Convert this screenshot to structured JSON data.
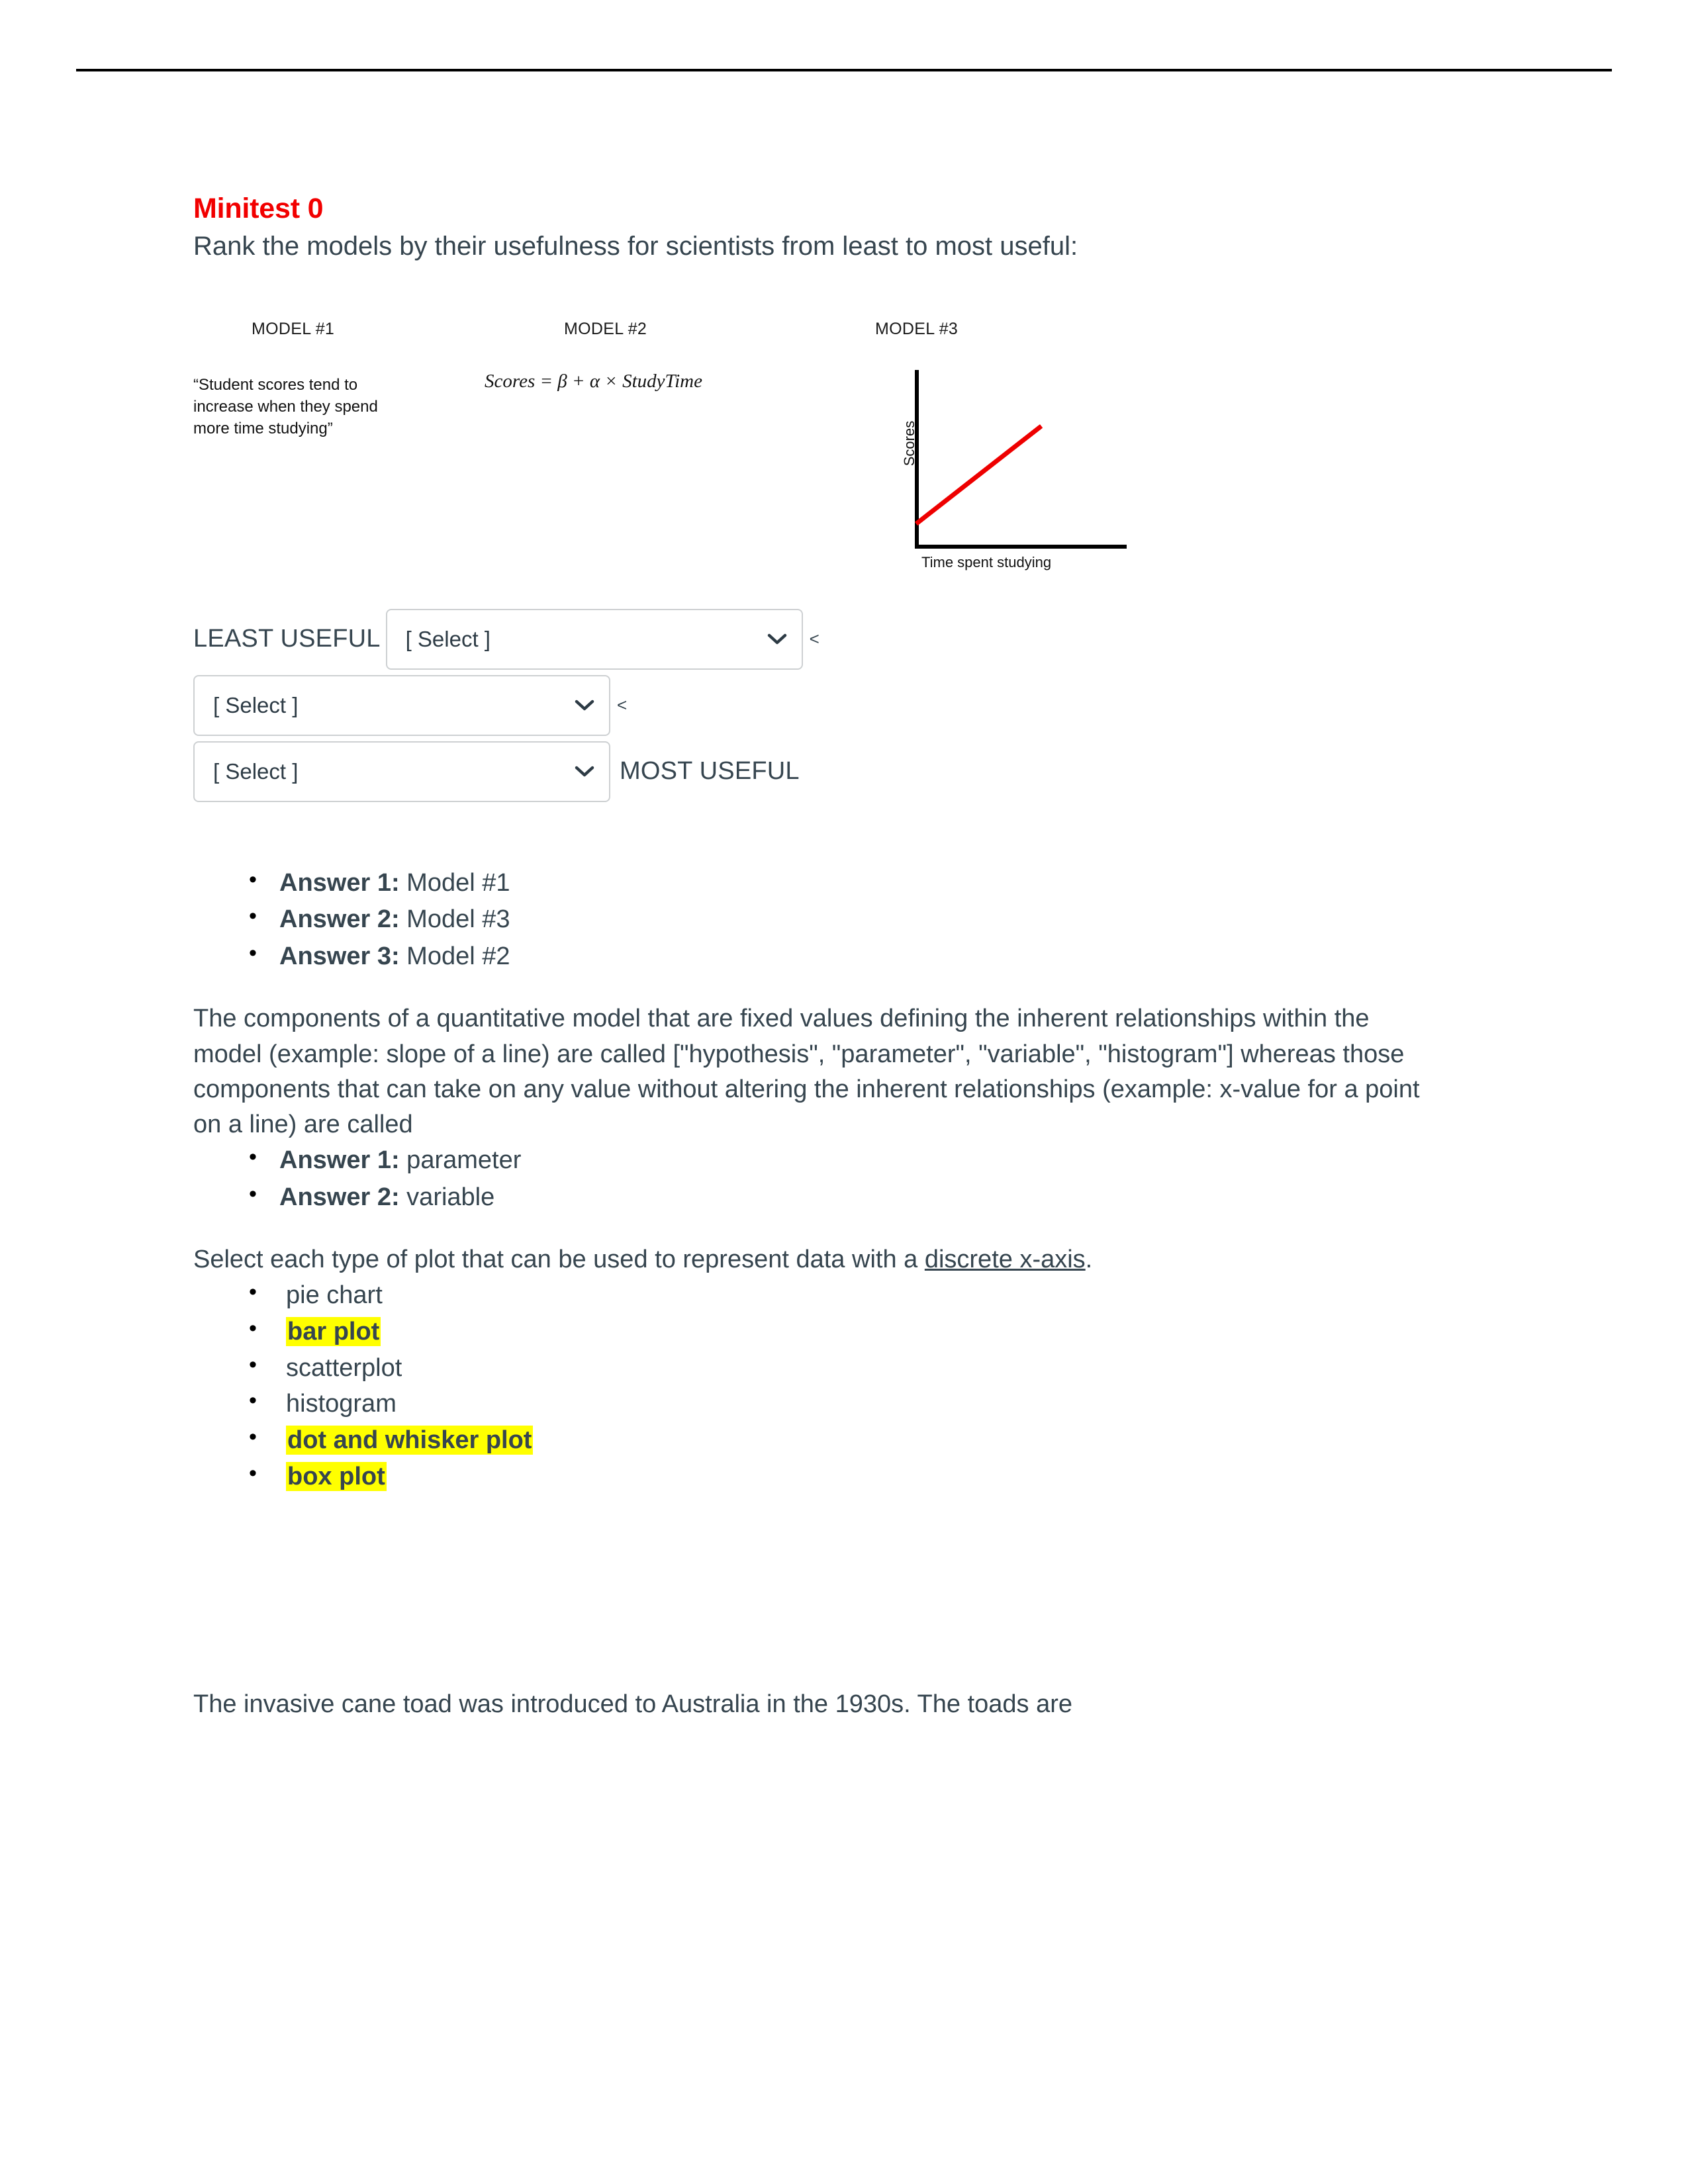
{
  "document": {
    "title": "Minitest 0",
    "title_color": "#f20000",
    "body_text_color": "#36454f",
    "highlight_color": "#ffff00"
  },
  "intro": {
    "prompt": "Rank the models by their usefulness for scientists from least to most useful:"
  },
  "models_figure": {
    "model1": {
      "heading": "MODEL #1",
      "body": "“Student scores tend to increase when they spend more time studying”"
    },
    "model2": {
      "heading": "MODEL #2",
      "formula": "Scores = β + α × StudyTime"
    },
    "model3": {
      "heading": "MODEL #3",
      "y_axis_label": "Scores",
      "x_axis_label": "Time spent studying",
      "line_color": "#ee0000"
    }
  },
  "ranking": {
    "least_useful_label": "LEAST USEFUL",
    "most_useful_label": "MOST USEFUL",
    "comparator": "<",
    "selects": [
      {
        "value": "[ Select ]",
        "caret": "chevron-down-icon"
      },
      {
        "value": "[ Select ]",
        "caret": "chevron-down-icon"
      },
      {
        "value": "[ Select ]",
        "caret": "chevron-down-icon"
      }
    ]
  },
  "ranking_answers": [
    {
      "key": "Answer 1:",
      "value": " Model #1"
    },
    {
      "key": "Answer 2:",
      "value": " Model #3"
    },
    {
      "key": "Answer 3:",
      "value": " Model #2"
    }
  ],
  "parameter_question": {
    "paragraph": "The components of a quantitative model that are fixed values defining the inherent relationships within the model (example: slope of a line) are called [\"hypothesis\", \"parameter\", \"variable\", \"histogram\"] whereas those components that can take on any value without altering the inherent relationships (example: x-value for a point on a line) are called",
    "answers": [
      {
        "key": "Answer 1:",
        "value": " parameter"
      },
      {
        "key": "Answer 2:",
        "value": " variable"
      }
    ]
  },
  "plot_question": {
    "prompt_before": "Select each type of plot that can be used to represent data with a ",
    "prompt_underlined": "discrete x-axis",
    "prompt_after": ".",
    "options": [
      {
        "label": "pie chart",
        "highlighted": false
      },
      {
        "label": "bar plot",
        "highlighted": true
      },
      {
        "label": "scatterplot",
        "highlighted": false
      },
      {
        "label": "histogram",
        "highlighted": false
      },
      {
        "label": "dot and whisker plot",
        "highlighted": true
      },
      {
        "label": "box plot",
        "highlighted": true
      }
    ]
  },
  "tail": {
    "paragraph": "The invasive cane toad was introduced to Australia in the 1930s. The toads are"
  }
}
